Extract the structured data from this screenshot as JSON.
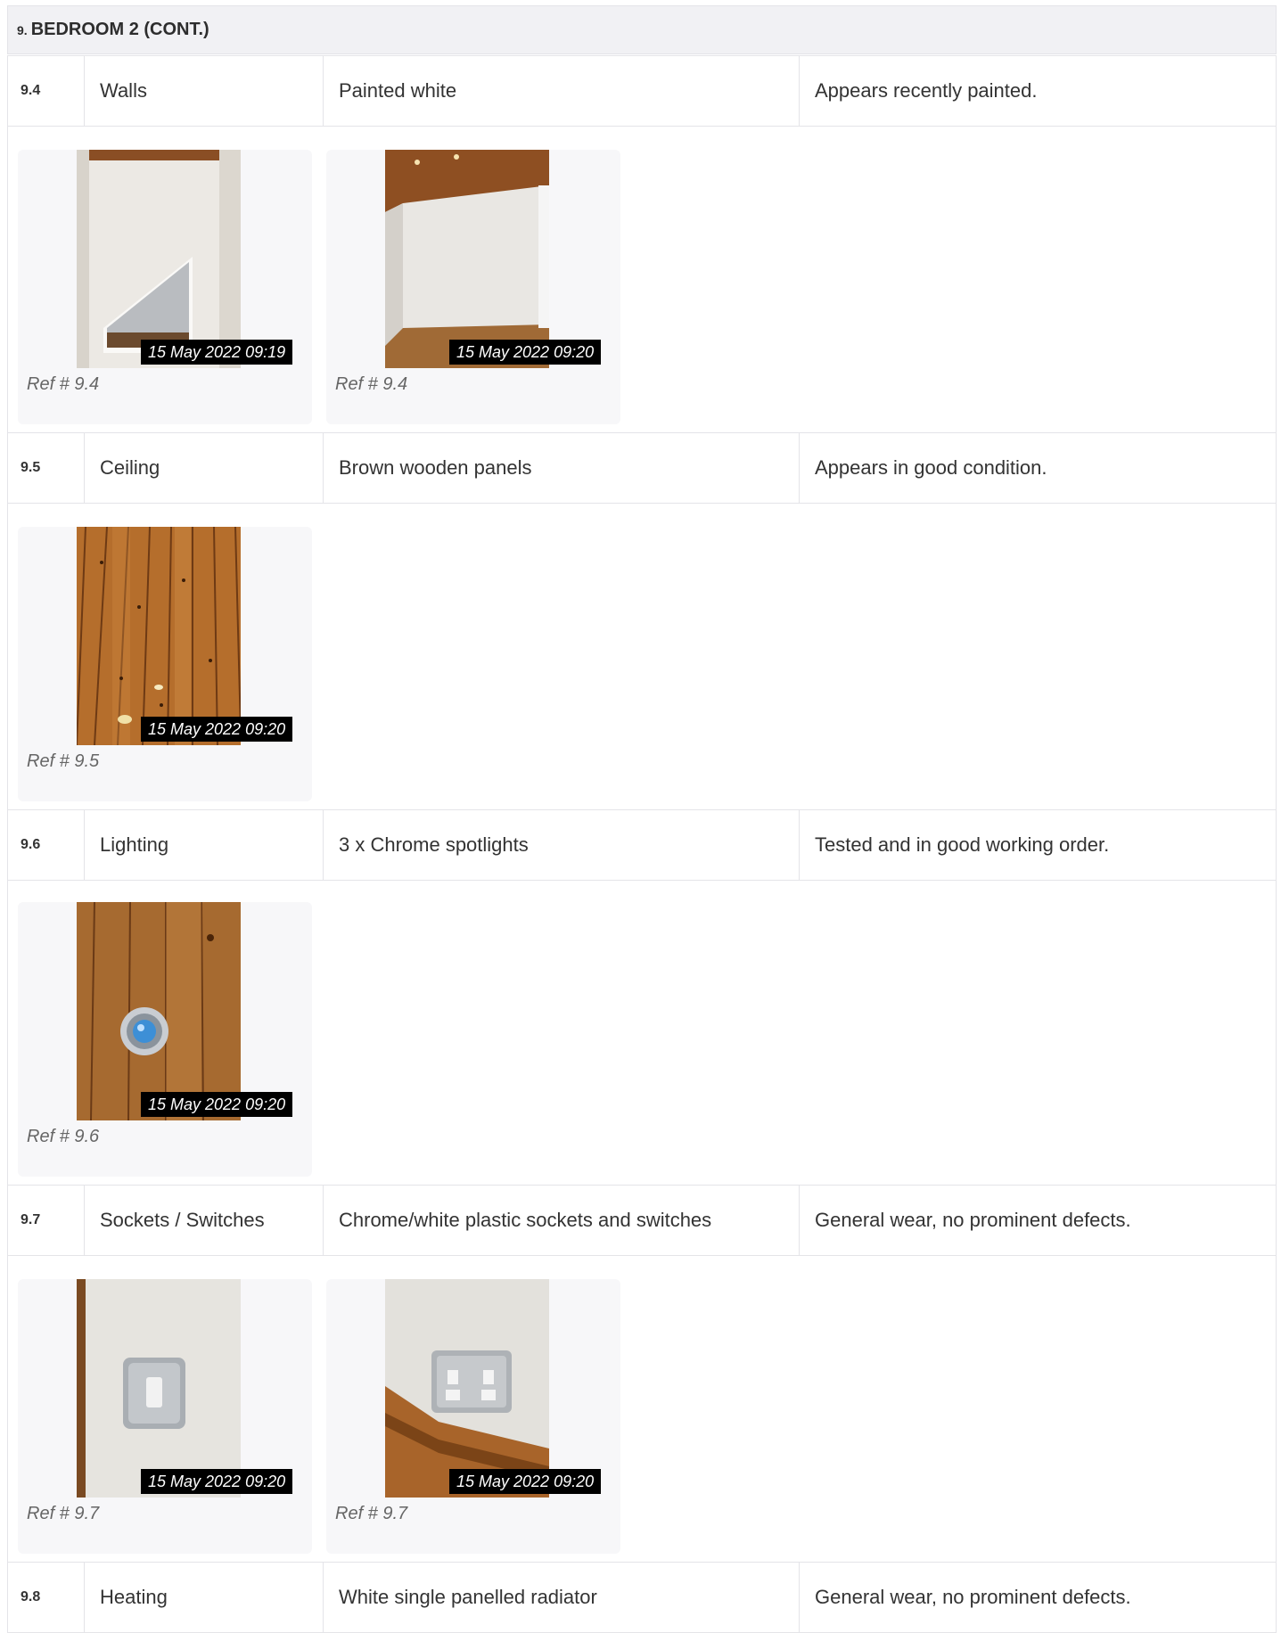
{
  "section": {
    "number": "9.",
    "title": "BEDROOM 2 (CONT.)"
  },
  "items": [
    {
      "ref": "9.4",
      "name": "Walls",
      "description": "Painted white",
      "condition": "Appears recently painted.",
      "photos": [
        {
          "timestamp": "15 May 2022 09:19",
          "caption": "Ref # 9.4",
          "subject": "white-wall-with-alcove"
        },
        {
          "timestamp": "15 May 2022 09:20",
          "caption": "Ref # 9.4",
          "subject": "white-wall-room-corner"
        }
      ]
    },
    {
      "ref": "9.5",
      "name": "Ceiling",
      "description": "Brown wooden panels",
      "condition": "Appears in good condition.",
      "photos": [
        {
          "timestamp": "15 May 2022 09:20",
          "caption": "Ref # 9.5",
          "subject": "wooden-ceiling-panels"
        }
      ]
    },
    {
      "ref": "9.6",
      "name": "Lighting",
      "description": "3 x Chrome spotlights",
      "condition": "Tested and in good working order.",
      "photos": [
        {
          "timestamp": "15 May 2022 09:20",
          "caption": "Ref # 9.6",
          "subject": "chrome-spotlight"
        }
      ]
    },
    {
      "ref": "9.7",
      "name": "Sockets / Switches",
      "description": "Chrome/white plastic sockets and switches",
      "condition": "General wear, no prominent defects.",
      "photos": [
        {
          "timestamp": "15 May 2022 09:20",
          "caption": "Ref # 9.7",
          "subject": "chrome-light-switch"
        },
        {
          "timestamp": "15 May 2022 09:20",
          "caption": "Ref # 9.7",
          "subject": "chrome-double-socket"
        }
      ]
    },
    {
      "ref": "9.8",
      "name": "Heating",
      "description": "White single panelled radiator",
      "condition": "General wear, no prominent defects.",
      "photos": []
    }
  ],
  "colors": {
    "header_bg": "#f1f1f4",
    "border": "#e4e4e8",
    "card_bg": "#f7f7f9",
    "stamp_bg": "#000000",
    "wood": "#b06a2a"
  }
}
